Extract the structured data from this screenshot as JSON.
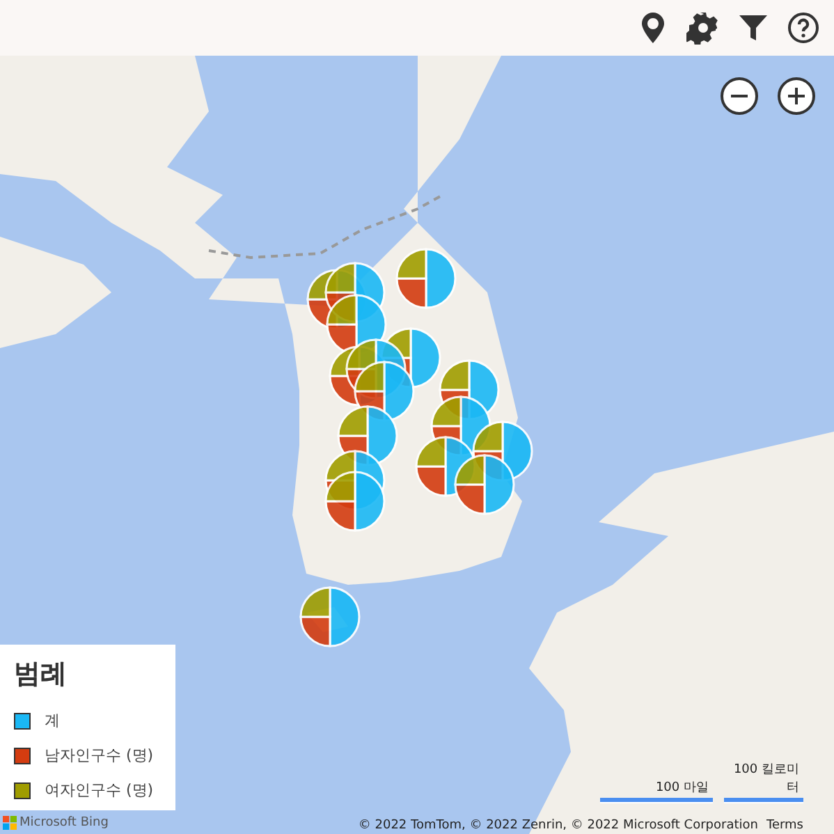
{
  "toolbar": {
    "icons": [
      {
        "kind": "pin"
      },
      {
        "kind": "gear"
      },
      {
        "kind": "filter"
      },
      {
        "kind": "help"
      }
    ]
  },
  "map": {
    "zoom_buttons": [
      {
        "kind": "out"
      },
      {
        "kind": "in"
      }
    ],
    "legend": {
      "title": "범례",
      "items": [
        {
          "label": "계",
          "color": "#1ab8f5"
        },
        {
          "label": "남자인구수 (명)",
          "color": "#d43c10"
        },
        {
          "label": "여자인구수 (명)",
          "color": "#a09d00"
        }
      ]
    },
    "logo": "Microsoft Bing",
    "scale": [
      {
        "label": "100 마일"
      },
      {
        "label": "100 킬로미\n터"
      }
    ],
    "attribution": "© 2022 TomTom, © 2022 Zenrin, © 2022 Microsoft Corporation",
    "terms_link": "Terms"
  }
}
